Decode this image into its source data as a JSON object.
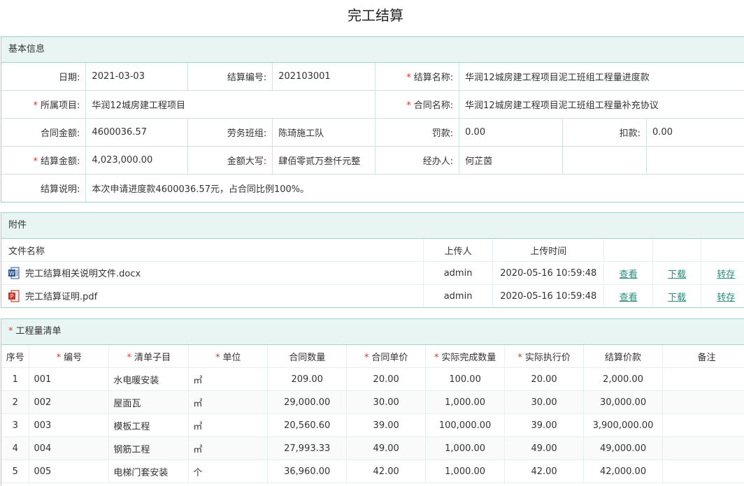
{
  "page": {
    "title": "完工结算"
  },
  "basic_info": {
    "header": "基本信息",
    "date_label": "日期:",
    "date_value": "2021-03-03",
    "code_label": "结算编号:",
    "code_value": "202103001",
    "name_label": "结算名称:",
    "name_value": "华润12城房建工程项目泥工班组工程量进度款",
    "project_label": "所属项目:",
    "project_value": "华润12城房建工程项目",
    "contract_name_label": "合同名称:",
    "contract_name_value": "华润12城房建工程项目泥工班组工程量补充协议",
    "contract_amount_label": "合同金额:",
    "contract_amount_value": "4600036.57",
    "team_label": "劳务班组:",
    "team_value": "陈琦施工队",
    "penalty_label": "罚款:",
    "penalty_value": "0.00",
    "deduction_label": "扣款:",
    "deduction_value": "0.00",
    "settle_amount_label": "结算金额:",
    "settle_amount_value": "4,023,000.00",
    "capital_label": "金额大写:",
    "capital_value": "肆佰零贰万叁仟元整",
    "handler_label": "经办人:",
    "handler_value": "何芷茵",
    "desc_label": "结算说明:",
    "desc_value": "本次申请进度款4600036.57元，占合同比例100%。"
  },
  "attachments": {
    "header": "附件",
    "columns": {
      "name": "文件名称",
      "uploader": "上传人",
      "time": "上传时间"
    },
    "files": [
      {
        "name": "完工结算相关说明文件.docx",
        "icon": "word-file-icon",
        "uploader": "admin",
        "time": "2020-05-16 10:59:48",
        "view": "查看",
        "download": "下载",
        "transfer": "转存"
      },
      {
        "name": "完工结算证明.pdf",
        "icon": "pdf-file-icon",
        "uploader": "admin",
        "time": "2020-05-16 10:59:48",
        "view": "查看",
        "download": "下载",
        "transfer": "转存"
      }
    ]
  },
  "boq": {
    "header": "工程量清单",
    "columns": {
      "seq": "序号",
      "code": "编号",
      "item": "清单子目",
      "unit": "单位",
      "contract_qty": "合同数量",
      "contract_price": "合同单价",
      "actual_qty": "实际完成数量",
      "actual_price": "实际执行价",
      "settle_price": "结算价款",
      "remark": "备注"
    },
    "rows": [
      {
        "seq": "1",
        "code": "001",
        "item": "水电暖安装",
        "unit": "㎡",
        "contract_qty": "209.00",
        "contract_price": "20.00",
        "actual_qty": "100.00",
        "actual_price": "20.00",
        "settle_price": "2,000.00",
        "remark": ""
      },
      {
        "seq": "2",
        "code": "002",
        "item": "屋面瓦",
        "unit": "㎡",
        "contract_qty": "29,000.00",
        "contract_price": "30.00",
        "actual_qty": "1,000.00",
        "actual_price": "30.00",
        "settle_price": "30,000.00",
        "remark": ""
      },
      {
        "seq": "3",
        "code": "003",
        "item": "模板工程",
        "unit": "㎡",
        "contract_qty": "20,560.60",
        "contract_price": "39.00",
        "actual_qty": "100,000.00",
        "actual_price": "39.00",
        "settle_price": "3,900,000.00",
        "remark": ""
      },
      {
        "seq": "4",
        "code": "004",
        "item": "钢筋工程",
        "unit": "㎡",
        "contract_qty": "27,993.33",
        "contract_price": "49.00",
        "actual_qty": "1,000.00",
        "actual_price": "49.00",
        "settle_price": "49,000.00",
        "remark": ""
      },
      {
        "seq": "5",
        "code": "005",
        "item": "电梯门套安装",
        "unit": "个",
        "contract_qty": "36,960.00",
        "contract_price": "42.00",
        "actual_qty": "1,000.00",
        "actual_price": "42.00",
        "settle_price": "42,000.00",
        "remark": ""
      }
    ]
  },
  "colors": {
    "border": "#9fd0cb",
    "panel_header_bg": "#e9f5f3",
    "required": "#e0382f",
    "link": "#2a8a7d"
  }
}
